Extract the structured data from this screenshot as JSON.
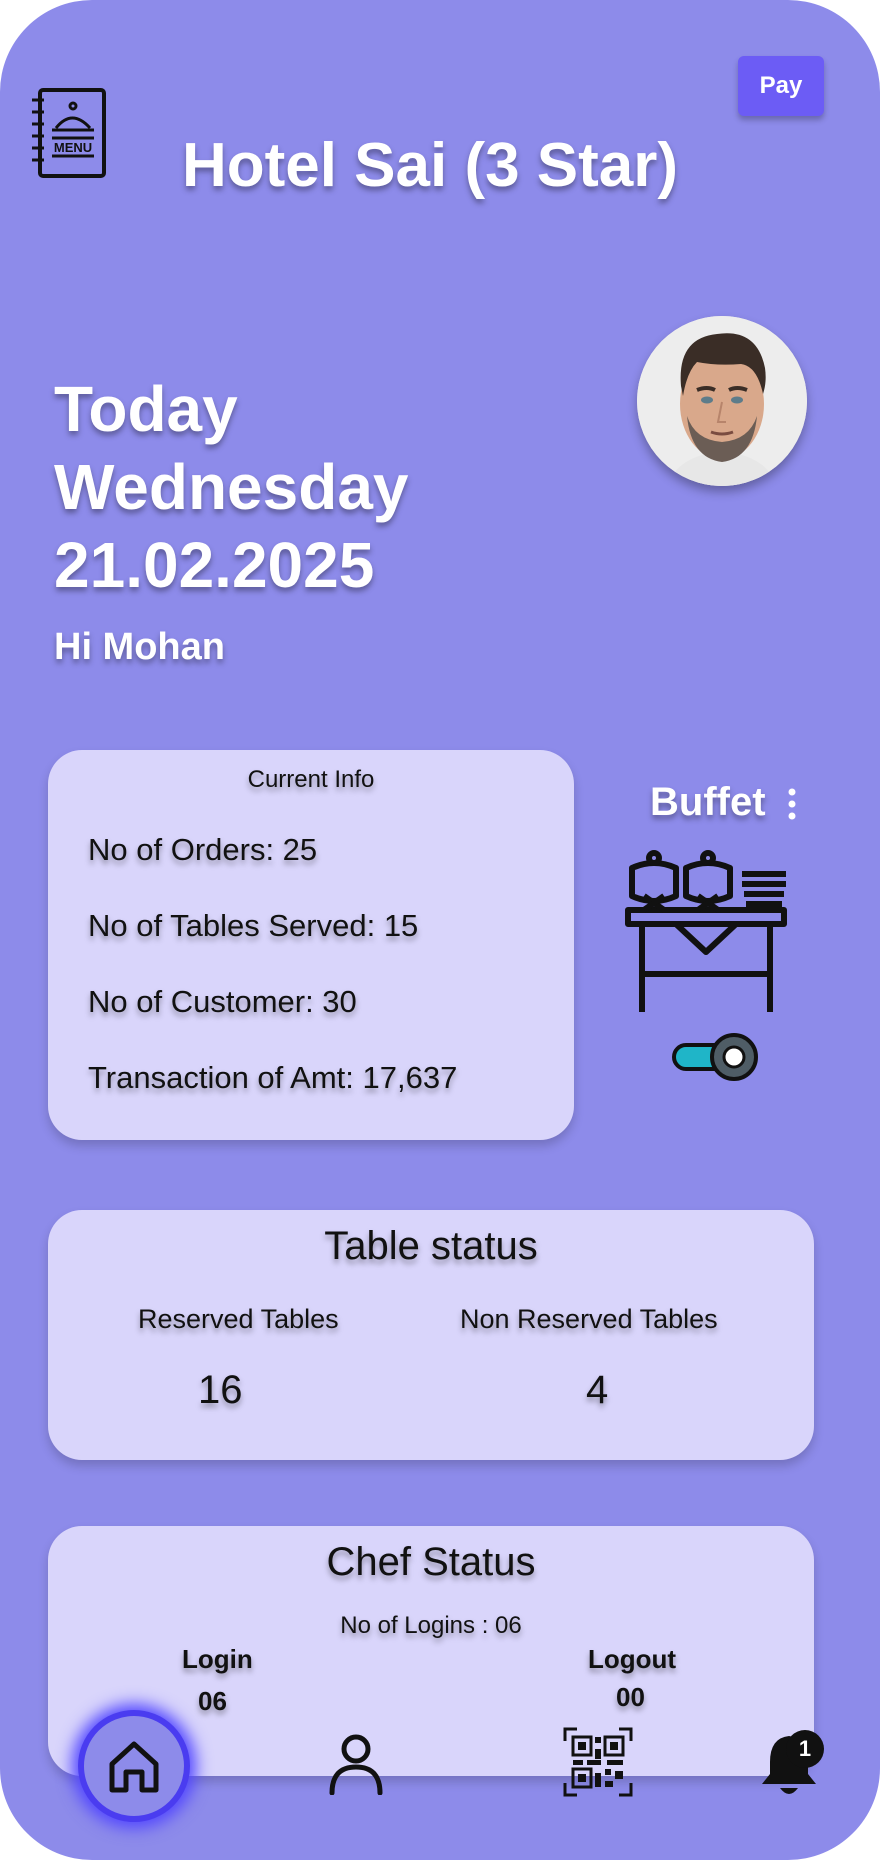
{
  "header": {
    "pay_label": "Pay",
    "menu_icon": "menu-book-icon",
    "menu_icon_text": "MENU",
    "hotel_name": "Hotel Sai (3 Star)"
  },
  "date_block": {
    "line1": "Today",
    "line2": "Wednesday",
    "line3": "21.02.2025"
  },
  "greeting": "Hi Mohan",
  "current_info": {
    "title": "Current Info",
    "rows": [
      "No of Orders: 25",
      "No of Tables Served: 15",
      "No of Customer: 30",
      "Transaction of Amt: 17,637"
    ]
  },
  "buffet": {
    "label": "Buffet",
    "toggle_on": true
  },
  "table_status": {
    "title": "Table status",
    "reserved_label": "Reserved Tables",
    "reserved_value": "16",
    "non_reserved_label": "Non Reserved Tables",
    "non_reserved_value": "4"
  },
  "chef_status": {
    "title": "Chef Status",
    "logins_text": "No of Logins : 06",
    "login_label": "Login",
    "login_value": "06",
    "logout_label": "Logout",
    "logout_value": "00"
  },
  "bottom_nav": {
    "items": [
      "home-icon",
      "profile-icon",
      "qr-code-icon",
      "bell-icon"
    ],
    "notification_count": "1"
  },
  "colors": {
    "background": "#8d8bea",
    "card": "#d9d5fb",
    "pay_button": "#6c5cf5",
    "home_ring": "#4a3cf0",
    "toggle_accent": "#1fb5c8"
  }
}
